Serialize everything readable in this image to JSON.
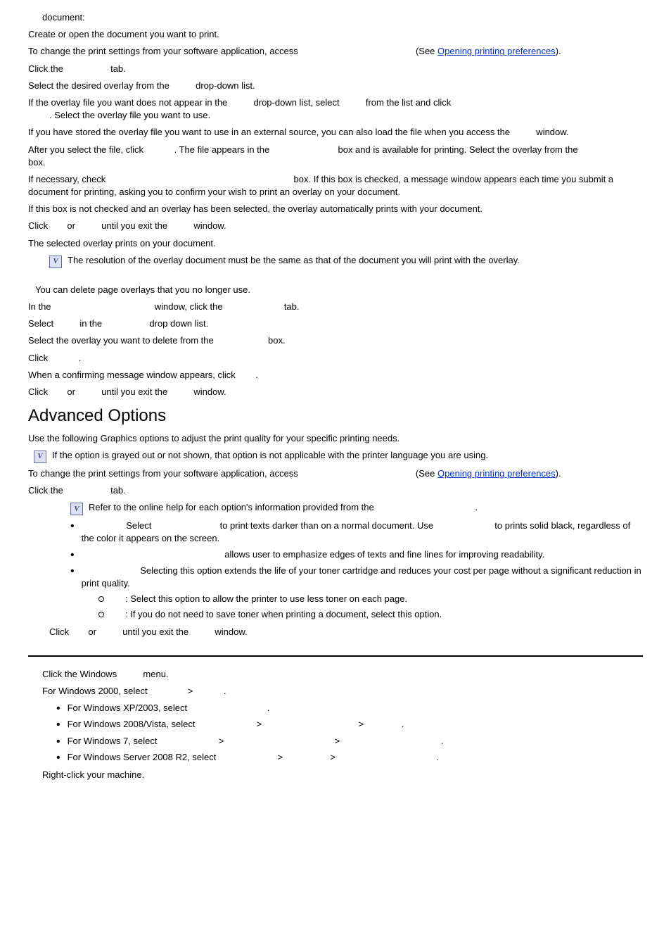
{
  "top": {
    "document_label": "document:",
    "l1": "Create or open the document you want to print.",
    "l2a": "To change the print settings from your software application, access ",
    "l2b": " (See ",
    "link_open": "Opening printing preferences",
    "l2c": ").",
    "l3a": "Click the ",
    "l3b": " tab.",
    "l4a": "Select the desired overlay from the ",
    "l4b": " drop-down list.",
    "l5a": "If the overlay file you want does not appear in the ",
    "l5b": " drop-down list, select ",
    "l5c": " from the list and click ",
    "l5d": ". Select the overlay file you want to use.",
    "l6a": "If you have stored the overlay file you want to use in an external source, you can also load the file when you access the ",
    "l6b": " window.",
    "l7a": "After you select the file, click ",
    "l7b": ". The file appears in the ",
    "l7c": " box and is available for printing. Select the overlay from the ",
    "l7d": " box.",
    "l8a": "If necessary, check ",
    "l8b": " box. If this box is checked, a message window appears each time you submit a document for printing, asking you to confirm your wish to print an overlay on your document.",
    "l9": "If this box is not checked and an overlay has been selected, the overlay automatically prints with your document.",
    "l10a": "Click ",
    "l10b": " or ",
    "l10c": " until you exit the ",
    "l10d": " window.",
    "l11": "The selected overlay prints on your document.",
    "note1": "The resolution of the overlay document must be the same as that of the document you will print with the overlay."
  },
  "del": {
    "h": "You can delete page overlays that you no longer use.",
    "d1a": "In the ",
    "d1b": " window, click the ",
    "d1c": " tab.",
    "d2a": "Select ",
    "d2b": " in the ",
    "d2c": " drop down list.",
    "d3a": "Select the overlay you want to delete from the ",
    "d3b": " box.",
    "d4a": "Click ",
    "d4b": ".",
    "d5a": "When a confirming message window appears, click ",
    "d5b": ".",
    "d6a": "Click ",
    "d6b": " or ",
    "d6c": " until you exit the ",
    "d6d": " window."
  },
  "adv": {
    "heading": "Advanced Options",
    "intro": "Use the following Graphics options to adjust the print quality for your specific printing needs.",
    "note2": "If the option is grayed out or not shown, that option is not applicable with the printer language you are using.",
    "a1a": "To change the print settings from your software application, access ",
    "a1b": " (See ",
    "link_open2": "Opening printing preferences",
    "a1c": ").",
    "a2a": "Click the ",
    "a2b": " tab.",
    "note3a": "Refer to the online help for each option's information provided from the ",
    "note3b": ".",
    "b1a": " Select ",
    "b1b": " to print texts darker than on a normal document. Use ",
    "b1c": " to prints solid black, regardless of the color it appears on the screen.",
    "b2": " allows user to emphasize edges of texts and fine lines for improving readability.",
    "b3": " Selecting this option extends the life of your toner cartridge and reduces your cost per page without a significant reduction in print quality.",
    "s1": ": Select this option to allow the printer to use less toner on each page.",
    "s2": ": If you do not need to save toner when printing a document, select this option.",
    "a3a": "Click ",
    "a3b": " or ",
    "a3c": " until you exit the ",
    "a3d": " window."
  },
  "win": {
    "w1a": "Click the Windows ",
    "w1b": " menu.",
    "w2a": "For Windows 2000, select ",
    "w2b": " > ",
    "w2c": ".",
    "w3a": "For Windows XP/2003, select ",
    "w3b": ".",
    "w4a": "For Windows 2008/Vista, select ",
    "w4b": " > ",
    "w4c": " > ",
    "w4d": ".",
    "w5a": "For Windows 7, select ",
    "w5b": " > ",
    "w5c": " > ",
    "w5d": ".",
    "w6a": "For Windows Server 2008 R2, select ",
    "w6b": " > ",
    "w6c": " > ",
    "w6d": ".",
    "w7": "Right-click your machine."
  }
}
